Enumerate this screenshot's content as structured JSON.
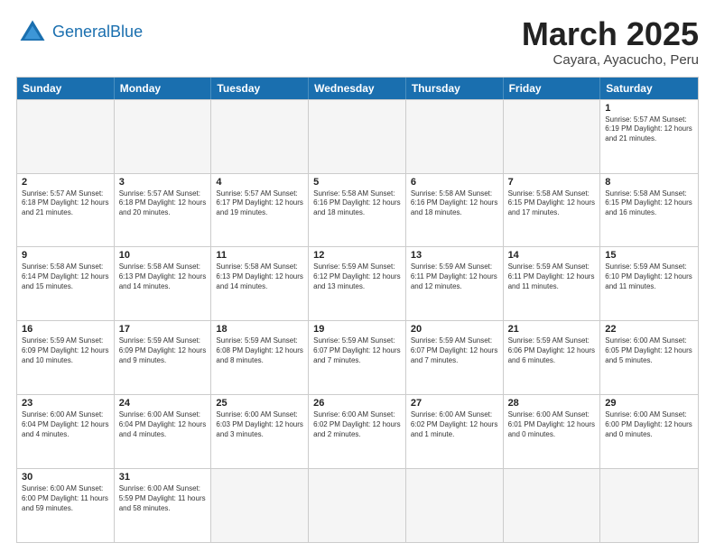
{
  "logo": {
    "line1": "General",
    "line2": "Blue"
  },
  "title": "March 2025",
  "subtitle": "Cayara, Ayacucho, Peru",
  "days": [
    "Sunday",
    "Monday",
    "Tuesday",
    "Wednesday",
    "Thursday",
    "Friday",
    "Saturday"
  ],
  "weeks": [
    [
      {
        "day": "",
        "text": ""
      },
      {
        "day": "",
        "text": ""
      },
      {
        "day": "",
        "text": ""
      },
      {
        "day": "",
        "text": ""
      },
      {
        "day": "",
        "text": ""
      },
      {
        "day": "",
        "text": ""
      },
      {
        "day": "1",
        "text": "Sunrise: 5:57 AM\nSunset: 6:19 PM\nDaylight: 12 hours and 21 minutes."
      }
    ],
    [
      {
        "day": "2",
        "text": "Sunrise: 5:57 AM\nSunset: 6:18 PM\nDaylight: 12 hours and 21 minutes."
      },
      {
        "day": "3",
        "text": "Sunrise: 5:57 AM\nSunset: 6:18 PM\nDaylight: 12 hours and 20 minutes."
      },
      {
        "day": "4",
        "text": "Sunrise: 5:57 AM\nSunset: 6:17 PM\nDaylight: 12 hours and 19 minutes."
      },
      {
        "day": "5",
        "text": "Sunrise: 5:58 AM\nSunset: 6:16 PM\nDaylight: 12 hours and 18 minutes."
      },
      {
        "day": "6",
        "text": "Sunrise: 5:58 AM\nSunset: 6:16 PM\nDaylight: 12 hours and 18 minutes."
      },
      {
        "day": "7",
        "text": "Sunrise: 5:58 AM\nSunset: 6:15 PM\nDaylight: 12 hours and 17 minutes."
      },
      {
        "day": "8",
        "text": "Sunrise: 5:58 AM\nSunset: 6:15 PM\nDaylight: 12 hours and 16 minutes."
      }
    ],
    [
      {
        "day": "9",
        "text": "Sunrise: 5:58 AM\nSunset: 6:14 PM\nDaylight: 12 hours and 15 minutes."
      },
      {
        "day": "10",
        "text": "Sunrise: 5:58 AM\nSunset: 6:13 PM\nDaylight: 12 hours and 14 minutes."
      },
      {
        "day": "11",
        "text": "Sunrise: 5:58 AM\nSunset: 6:13 PM\nDaylight: 12 hours and 14 minutes."
      },
      {
        "day": "12",
        "text": "Sunrise: 5:59 AM\nSunset: 6:12 PM\nDaylight: 12 hours and 13 minutes."
      },
      {
        "day": "13",
        "text": "Sunrise: 5:59 AM\nSunset: 6:11 PM\nDaylight: 12 hours and 12 minutes."
      },
      {
        "day": "14",
        "text": "Sunrise: 5:59 AM\nSunset: 6:11 PM\nDaylight: 12 hours and 11 minutes."
      },
      {
        "day": "15",
        "text": "Sunrise: 5:59 AM\nSunset: 6:10 PM\nDaylight: 12 hours and 11 minutes."
      }
    ],
    [
      {
        "day": "16",
        "text": "Sunrise: 5:59 AM\nSunset: 6:09 PM\nDaylight: 12 hours and 10 minutes."
      },
      {
        "day": "17",
        "text": "Sunrise: 5:59 AM\nSunset: 6:09 PM\nDaylight: 12 hours and 9 minutes."
      },
      {
        "day": "18",
        "text": "Sunrise: 5:59 AM\nSunset: 6:08 PM\nDaylight: 12 hours and 8 minutes."
      },
      {
        "day": "19",
        "text": "Sunrise: 5:59 AM\nSunset: 6:07 PM\nDaylight: 12 hours and 7 minutes."
      },
      {
        "day": "20",
        "text": "Sunrise: 5:59 AM\nSunset: 6:07 PM\nDaylight: 12 hours and 7 minutes."
      },
      {
        "day": "21",
        "text": "Sunrise: 5:59 AM\nSunset: 6:06 PM\nDaylight: 12 hours and 6 minutes."
      },
      {
        "day": "22",
        "text": "Sunrise: 6:00 AM\nSunset: 6:05 PM\nDaylight: 12 hours and 5 minutes."
      }
    ],
    [
      {
        "day": "23",
        "text": "Sunrise: 6:00 AM\nSunset: 6:04 PM\nDaylight: 12 hours and 4 minutes."
      },
      {
        "day": "24",
        "text": "Sunrise: 6:00 AM\nSunset: 6:04 PM\nDaylight: 12 hours and 4 minutes."
      },
      {
        "day": "25",
        "text": "Sunrise: 6:00 AM\nSunset: 6:03 PM\nDaylight: 12 hours and 3 minutes."
      },
      {
        "day": "26",
        "text": "Sunrise: 6:00 AM\nSunset: 6:02 PM\nDaylight: 12 hours and 2 minutes."
      },
      {
        "day": "27",
        "text": "Sunrise: 6:00 AM\nSunset: 6:02 PM\nDaylight: 12 hours and 1 minute."
      },
      {
        "day": "28",
        "text": "Sunrise: 6:00 AM\nSunset: 6:01 PM\nDaylight: 12 hours and 0 minutes."
      },
      {
        "day": "29",
        "text": "Sunrise: 6:00 AM\nSunset: 6:00 PM\nDaylight: 12 hours and 0 minutes."
      }
    ],
    [
      {
        "day": "30",
        "text": "Sunrise: 6:00 AM\nSunset: 6:00 PM\nDaylight: 11 hours and 59 minutes."
      },
      {
        "day": "31",
        "text": "Sunrise: 6:00 AM\nSunset: 5:59 PM\nDaylight: 11 hours and 58 minutes."
      },
      {
        "day": "",
        "text": ""
      },
      {
        "day": "",
        "text": ""
      },
      {
        "day": "",
        "text": ""
      },
      {
        "day": "",
        "text": ""
      },
      {
        "day": "",
        "text": ""
      }
    ]
  ]
}
